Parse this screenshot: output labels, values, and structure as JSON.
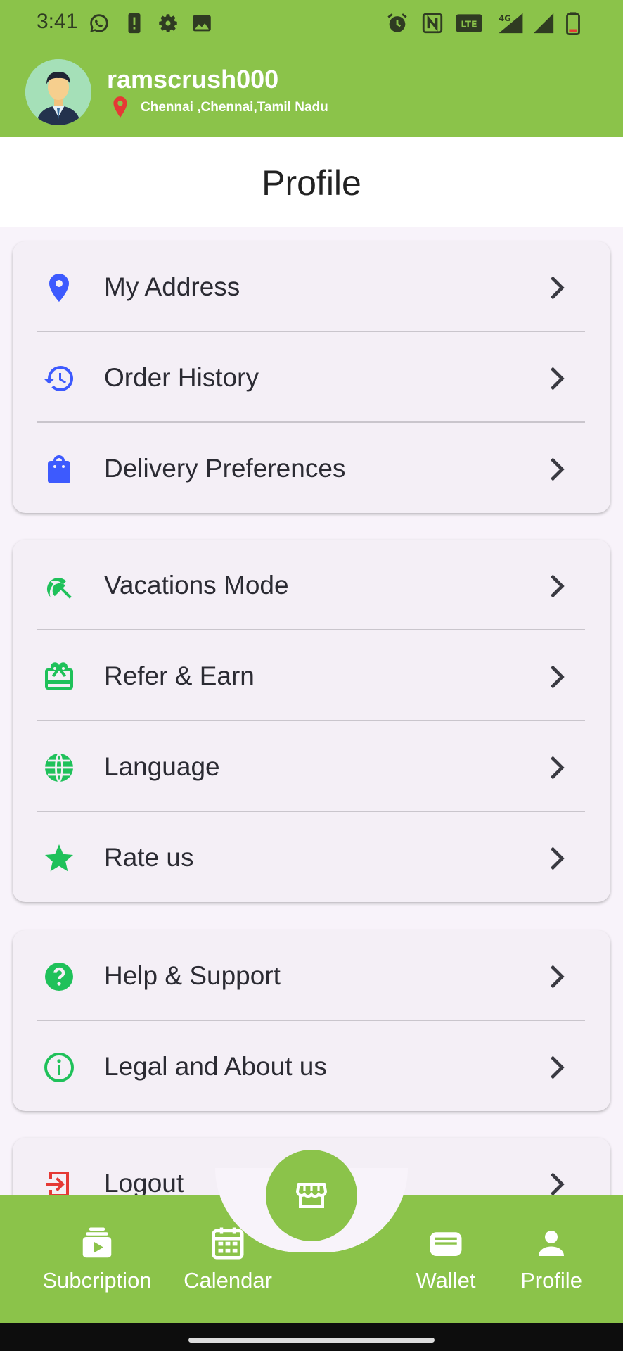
{
  "status_bar": {
    "time": "3:41",
    "icons": [
      "whatsapp-icon",
      "alert-icon",
      "gear-icon",
      "image-icon",
      "alarm-icon",
      "nfc-icon",
      "volte-icon",
      "4g-signal-icon",
      "signal-icon",
      "battery-icon"
    ]
  },
  "header": {
    "username": "ramscrush000",
    "location": "Chennai ,Chennai,Tamil Nadu"
  },
  "page": {
    "title": "Profile"
  },
  "colors": {
    "brand_green": "#8bc34a",
    "icon_blue": "#3d5afe",
    "icon_green": "#1fc15a",
    "icon_red": "#e53935"
  },
  "menu": {
    "group1": [
      {
        "label": "My Address",
        "icon": "location-pin-icon"
      },
      {
        "label": "Order History",
        "icon": "history-icon"
      },
      {
        "label": "Delivery Preferences",
        "icon": "shopping-bag-icon"
      }
    ],
    "group2": [
      {
        "label": "Vacations Mode",
        "icon": "beach-umbrella-icon"
      },
      {
        "label": "Refer & Earn",
        "icon": "gift-card-icon"
      },
      {
        "label": "Language",
        "icon": "globe-icon"
      },
      {
        "label": "Rate us",
        "icon": "star-icon"
      }
    ],
    "group3": [
      {
        "label": "Help & Support",
        "icon": "help-icon"
      },
      {
        "label": "Legal and About us",
        "icon": "info-icon"
      }
    ],
    "group4": [
      {
        "label": "Logout",
        "icon": "logout-icon"
      }
    ]
  },
  "bottom_nav": {
    "items": [
      {
        "label": "Subcription",
        "icon": "subscription-icon"
      },
      {
        "label": "Calendar",
        "icon": "calendar-icon"
      },
      {
        "label": "Wallet",
        "icon": "wallet-icon"
      },
      {
        "label": "Profile",
        "icon": "person-icon"
      }
    ],
    "center_icon": "store-icon"
  }
}
